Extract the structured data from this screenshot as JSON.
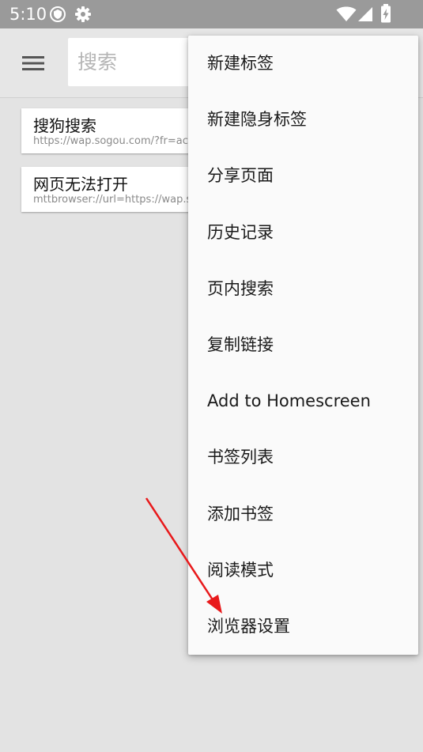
{
  "status_bar": {
    "time": "5:10",
    "icons": [
      "shield-notification-icon",
      "settings-gear-icon",
      "wifi-icon",
      "cell-signal-icon",
      "battery-charging-icon"
    ]
  },
  "toolbar": {
    "menu_icon": "hamburger-menu-icon",
    "search_placeholder": "搜索"
  },
  "results": [
    {
      "title": "搜狗搜索",
      "url": "https://wap.sogou.com/?fr=ac"
    },
    {
      "title": "网页无法打开",
      "url": "mttbrowser://url=https://wap.s"
    }
  ],
  "menu": {
    "items": [
      "新建标签",
      "新建隐身标签",
      "分享页面",
      "历史记录",
      "页内搜索",
      "复制链接",
      "Add to Homescreen",
      "书签列表",
      "添加书签",
      "阅读模式",
      "浏览器设置"
    ]
  },
  "annotation": {
    "color": "#e8191b",
    "points_to": "浏览器设置"
  },
  "colors": {
    "status_bar": "#9a9a9a",
    "background": "#e3e3e3",
    "menu_bg": "#fafafa"
  }
}
